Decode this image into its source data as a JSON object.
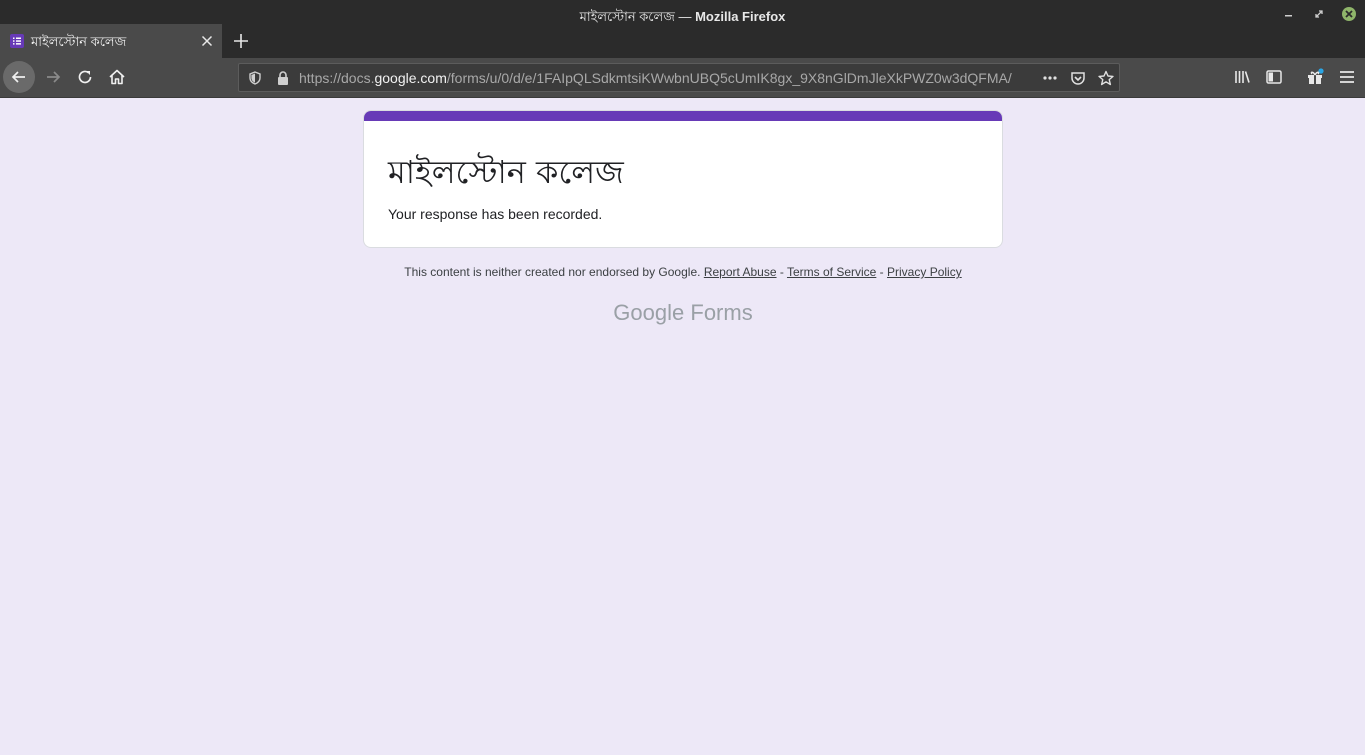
{
  "window": {
    "title_page": "মাইলস্টোন কলেজ",
    "title_sep": " — ",
    "title_app": "Mozilla Firefox"
  },
  "tab": {
    "label": "মাইলস্টোন কলেজ",
    "icon": "forms-list-icon"
  },
  "urlbar": {
    "url_prefix": "https://docs.",
    "url_host": "google.com",
    "url_path": "/forms/u/0/d/e/1FAIpQLSdkmtsiKWwbnUBQ5cUmIK8gx_9X8nGlDmJleXkPWZ0w3dQFMA/"
  },
  "form": {
    "title": "মাইলস্টোন কলেজ",
    "confirmation": "Your response has been recorded.",
    "accent_color": "#673ab7"
  },
  "footer": {
    "disclaimer": "This content is neither created nor endorsed by Google.",
    "report_abuse": "Report Abuse",
    "terms": "Terms of Service",
    "privacy": "Privacy Policy",
    "dash": " - "
  },
  "brand": {
    "google": "Google",
    "forms": "Forms"
  }
}
